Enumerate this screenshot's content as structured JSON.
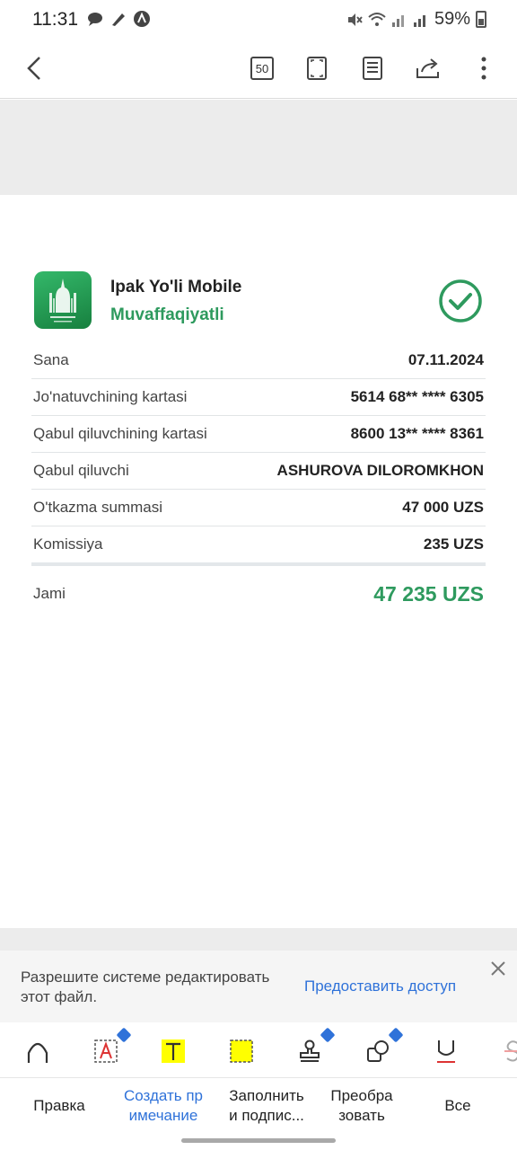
{
  "status_bar": {
    "time": "11:31",
    "battery": "59%"
  },
  "toolbar": {
    "page_count": "50"
  },
  "receipt": {
    "app_name": "Ipak Yo'li Mobile",
    "status": "Muvaffaqiyatli",
    "rows": [
      {
        "label": "Sana",
        "value": "07.11.2024"
      },
      {
        "label": "Jo'natuvchining kartasi",
        "value": "5614 68** **** 6305"
      },
      {
        "label": "Qabul qiluvchining kartasi",
        "value": "8600 13** **** 8361"
      },
      {
        "label": "Qabul qiluvchi",
        "value": "ASHUROVA DILOROMKHON"
      },
      {
        "label": "O'tkazma summasi",
        "value": "47 000 UZS"
      },
      {
        "label": "Komissiya",
        "value": "235 UZS"
      }
    ],
    "total_label": "Jami",
    "total_value": "47 235 UZS"
  },
  "banner": {
    "text": "Разрешите системе редактировать этот файл.",
    "action": "Предоставить доступ"
  },
  "tabs": [
    {
      "label": "Правка"
    },
    {
      "label": "Создать пр\nимечание"
    },
    {
      "label": "Заполнить\nи подпис..."
    },
    {
      "label": "Преобра\nзовать"
    },
    {
      "label": "Все"
    }
  ],
  "colors": {
    "accent_green": "#2e9a5e",
    "link_blue": "#2f72d9",
    "highlight_yellow": "#ffff00"
  }
}
